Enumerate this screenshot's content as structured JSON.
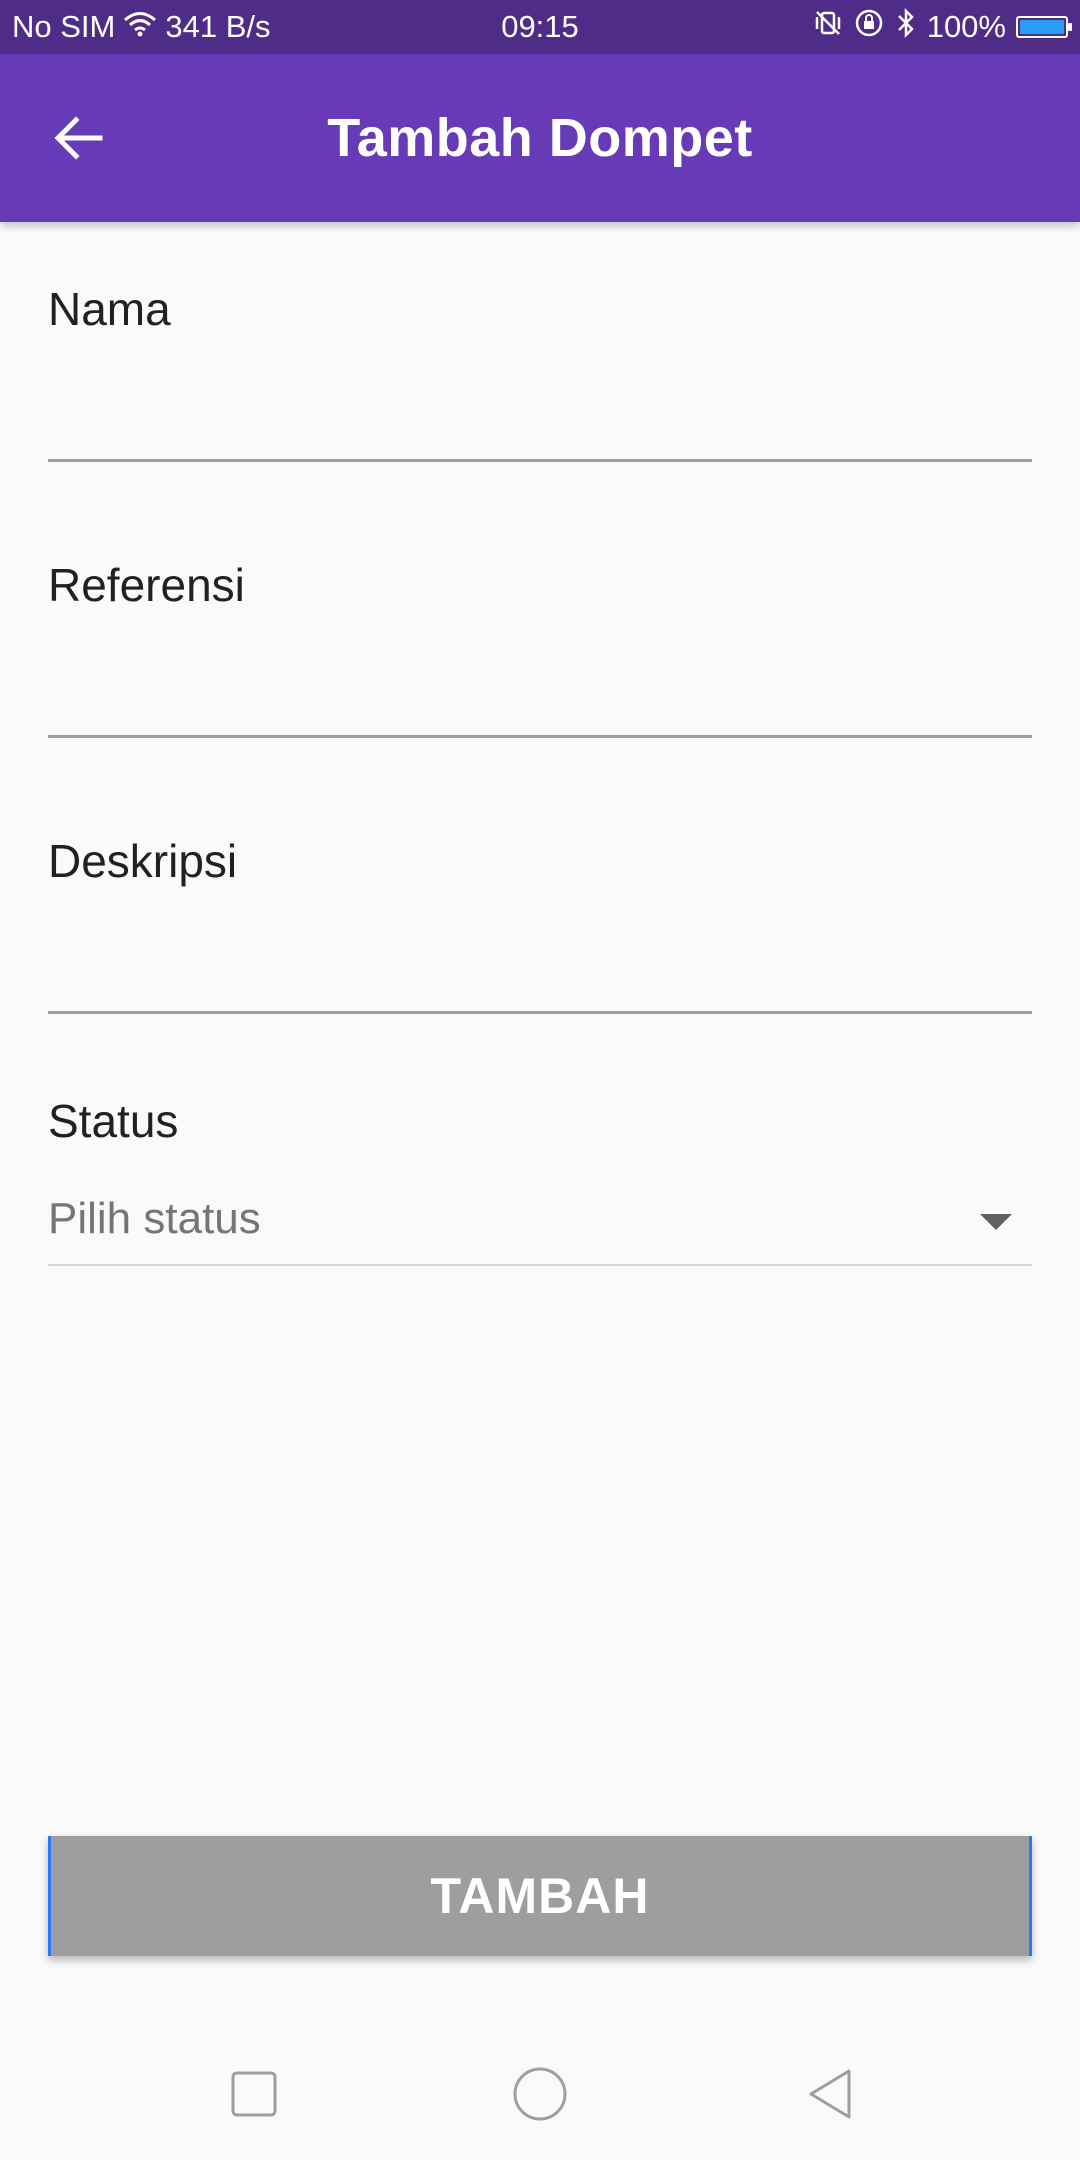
{
  "status_bar": {
    "carrier": "No SIM",
    "network_speed": "341 B/s",
    "time": "09:15",
    "battery_percent": "100%",
    "battery_level": 1.0,
    "icons": [
      "wifi-icon",
      "vibrate-off-icon",
      "rotation-lock-icon",
      "bluetooth-icon",
      "battery-icon"
    ]
  },
  "app_bar": {
    "title": "Tambah Dompet",
    "back_icon": "arrow-left-icon"
  },
  "form": {
    "fields": [
      {
        "label": "Nama",
        "value": "",
        "placeholder": ""
      },
      {
        "label": "Referensi",
        "value": "",
        "placeholder": ""
      },
      {
        "label": "Deskripsi",
        "value": "",
        "placeholder": ""
      }
    ],
    "status": {
      "label": "Status",
      "placeholder": "Pilih status",
      "icon": "arrow-drop-down-icon"
    }
  },
  "submit_label": "TAMBAH",
  "nav_bar": {
    "icons": [
      "recent-apps-icon",
      "home-icon",
      "back-icon"
    ]
  },
  "colors": {
    "primary": "#673ab7",
    "status_bar": "#4f2c88",
    "button_disabled": "#9e9e9e",
    "accent": "#2979ff"
  }
}
